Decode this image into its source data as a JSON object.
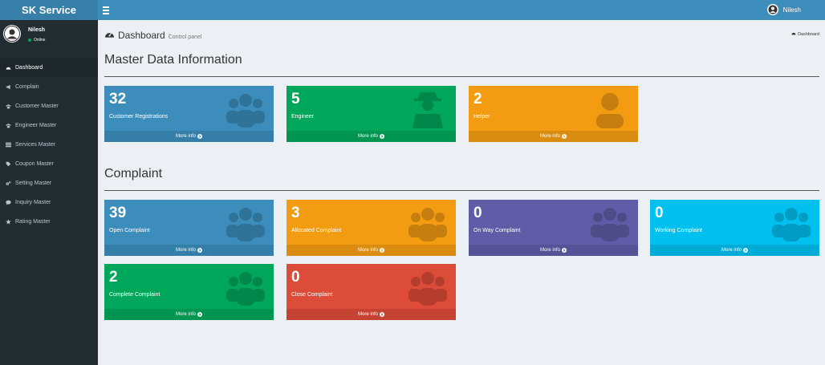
{
  "app": {
    "title": "SK Service"
  },
  "header": {
    "user_name": "Nilesh"
  },
  "sidebar": {
    "user": {
      "name": "Nilesh",
      "status": "Online"
    },
    "items": [
      {
        "label": "Dashboard",
        "icon": "dashboard-icon"
      },
      {
        "label": "Complain",
        "icon": "bullhorn-icon"
      },
      {
        "label": "Customer Master",
        "icon": "users-icon"
      },
      {
        "label": "Engineer Master",
        "icon": "users-icon"
      },
      {
        "label": "Services Master",
        "icon": "list-icon"
      },
      {
        "label": "Coupon Master",
        "icon": "tag-icon"
      },
      {
        "label": "Setting Master",
        "icon": "gears-icon"
      },
      {
        "label": "Inquiry Master",
        "icon": "comment-icon"
      },
      {
        "label": "Rating Master",
        "icon": "star-icon"
      }
    ]
  },
  "page": {
    "title": "Dashboard",
    "subtitle": "Control panel",
    "breadcrumb": "Dashboard"
  },
  "master": {
    "title": "Master Data Information",
    "boxes": [
      {
        "value": "32",
        "label": "Customer Registrations",
        "footer": "More info",
        "color": "#3c8dbc",
        "icon": "users-icon"
      },
      {
        "value": "5",
        "label": "Engineer",
        "footer": "More info",
        "color": "#00a65a",
        "icon": "user-secret-icon"
      },
      {
        "value": "2",
        "label": "Helper",
        "footer": "More info",
        "color": "#f39c12",
        "icon": "user-icon"
      }
    ]
  },
  "complaint": {
    "title": "Complaint",
    "boxes": [
      {
        "value": "39",
        "label": "Open Complaint",
        "footer": "More info",
        "color": "#3c8dbc",
        "icon": "users-icon"
      },
      {
        "value": "3",
        "label": "Allocated Complaint",
        "footer": "More info",
        "color": "#f39c12",
        "icon": "users-icon"
      },
      {
        "value": "0",
        "label": "On Way Complaint",
        "footer": "More info",
        "color": "#605ca8",
        "icon": "users-icon"
      },
      {
        "value": "0",
        "label": "Working Complaint",
        "footer": "More info",
        "color": "#00c0ef",
        "icon": "users-icon"
      },
      {
        "value": "2",
        "label": "Complete Complaint",
        "footer": "More info",
        "color": "#00a65a",
        "icon": "users-icon"
      },
      {
        "value": "0",
        "label": "Close Complaint",
        "footer": "More info",
        "color": "#dd4b39",
        "icon": "users-icon"
      }
    ]
  }
}
